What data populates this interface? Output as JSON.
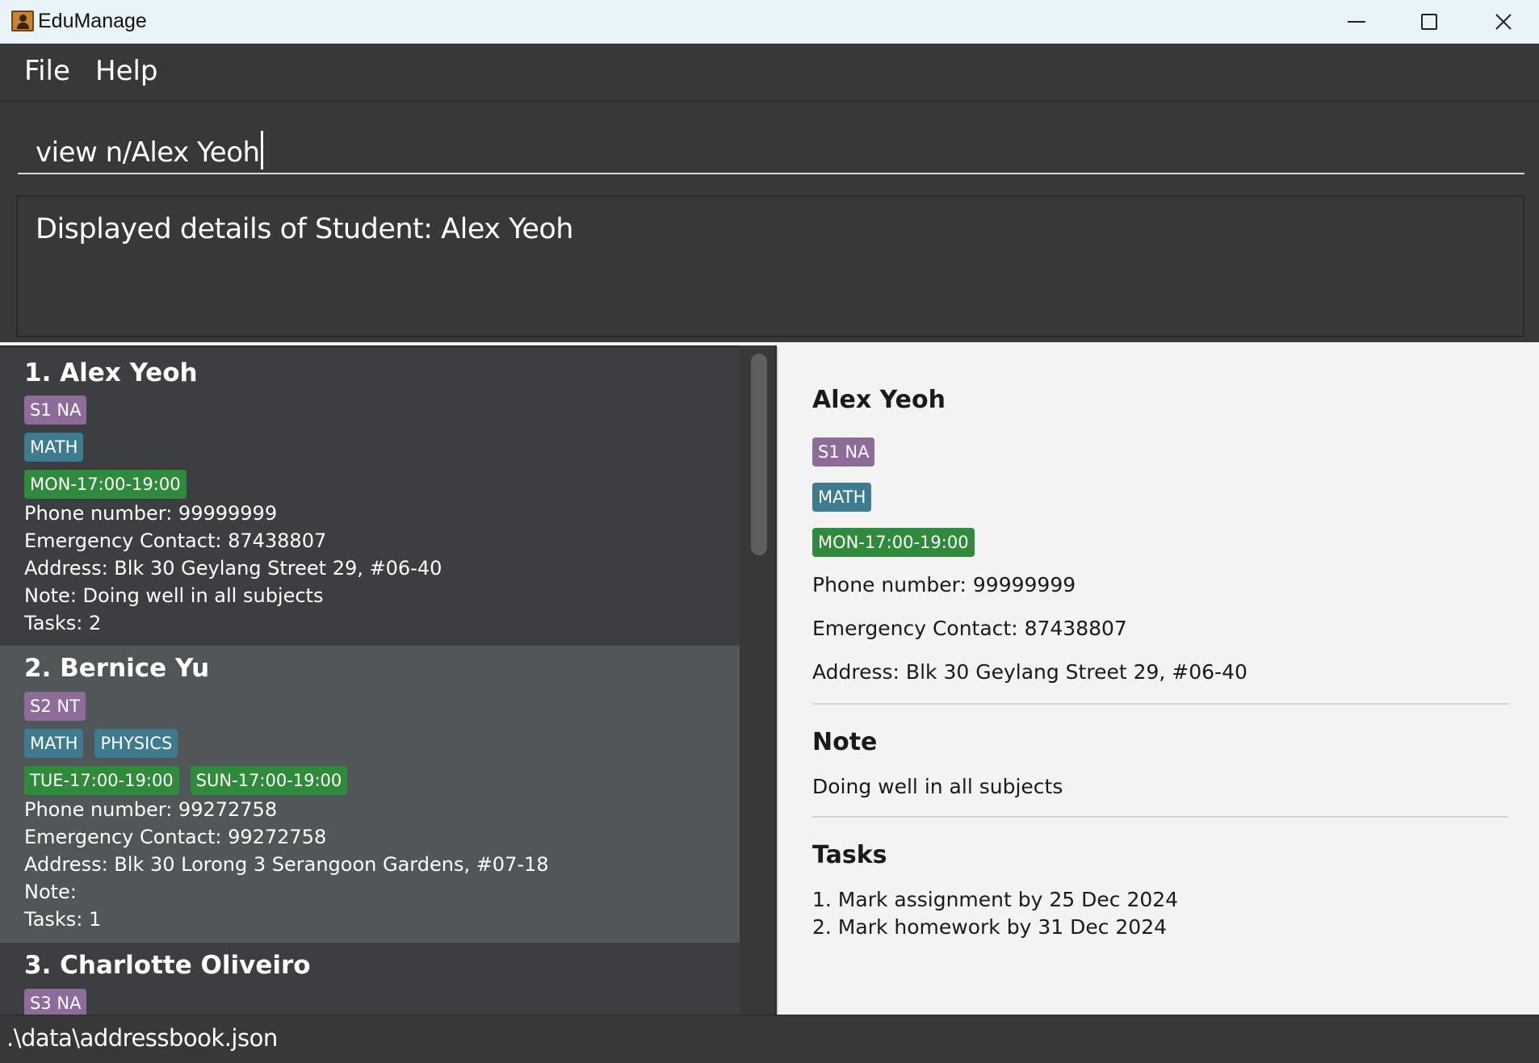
{
  "window": {
    "title": "EduManage",
    "icon": "app-contact-icon"
  },
  "menu": {
    "file": "File",
    "help": "Help"
  },
  "command": {
    "value": "view n/Alex Yeoh"
  },
  "result": {
    "message": "Displayed details of Student: Alex Yeoh"
  },
  "students": [
    {
      "name": "1. Alex Yeoh",
      "level": "S1 NA",
      "subjects": [
        "MATH"
      ],
      "classes": [
        "MON-17:00-19:00"
      ],
      "phone": "Phone number: 99999999",
      "emergency": "Emergency Contact: 87438807",
      "address": "Address: Blk 30 Geylang Street 29, #06-40",
      "note": "Note: Doing well in all subjects",
      "tasks": "Tasks: 2"
    },
    {
      "name": "2. Bernice Yu",
      "level": "S2 NT",
      "subjects": [
        "MATH",
        "PHYSICS"
      ],
      "classes": [
        "TUE-17:00-19:00",
        "SUN-17:00-19:00"
      ],
      "phone": "Phone number: 99272758",
      "emergency": "Emergency Contact: 99272758",
      "address": "Address: Blk 30 Lorong 3 Serangoon Gardens, #07-18",
      "note": "Note:",
      "tasks": "Tasks: 1"
    },
    {
      "name": "3. Charlotte Oliveiro",
      "level": "S3 NA"
    }
  ],
  "details": {
    "name": "Alex Yeoh",
    "level": "S1 NA",
    "subject": "MATH",
    "class": "MON-17:00-19:00",
    "phone": "Phone number: 99999999",
    "emergency": "Emergency Contact: 87438807",
    "address": "Address: Blk 30 Geylang Street 29, #06-40",
    "note_heading": "Note",
    "note": "Doing well in all subjects",
    "tasks_heading": "Tasks",
    "tasks": [
      "1. Mark assignment by 25 Dec 2024",
      "2. Mark homework by 31 Dec 2024"
    ]
  },
  "status": {
    "path": ".\\data\\addressbook.json"
  },
  "colors": {
    "level_badge": "#8d6c9a",
    "subject_badge": "#3f7b8e",
    "class_badge": "#2f8a3c",
    "dark_background": "#383838",
    "selected_card": "#515658"
  }
}
